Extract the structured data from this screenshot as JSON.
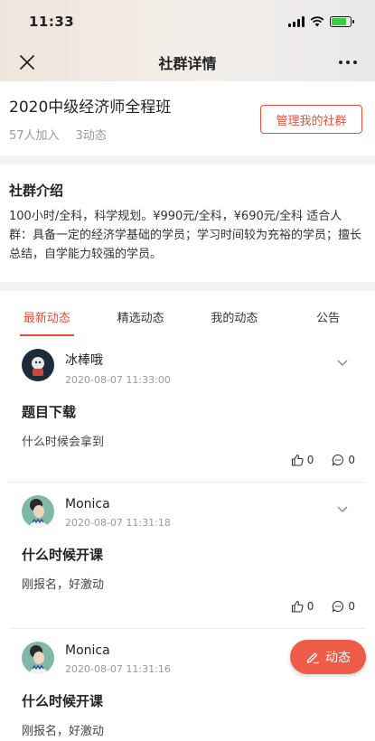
{
  "status_bar": {
    "time": "11:33",
    "battery_level": 0.8
  },
  "nav": {
    "title": "社群详情"
  },
  "group": {
    "name": "2020中级经济师全程班",
    "members": "57人加入",
    "posts": "3动态",
    "manage_label": "管理我的社群"
  },
  "intro": {
    "title": "社群介绍",
    "text": "100小时/全科，科学规划。¥990元/全科，¥690元/全科 适合人群：具备一定的经济学基础的学员；学习时间较为充裕的学员；擅长总结，自学能力较强的学员。"
  },
  "tabs": [
    "最新动态",
    "精选动态",
    "我的动态",
    "公告"
  ],
  "posts": [
    {
      "author": "冰棒哦",
      "time": "2020-08-07 11:33:00",
      "title": "题目下载",
      "body": "什么时候会拿到",
      "likes": "0",
      "comments": "0"
    },
    {
      "author": "Monica",
      "time": "2020-08-07 11:31:18",
      "title": "什么时候开课",
      "body": "刚报名，好激动",
      "likes": "0",
      "comments": "0"
    },
    {
      "author": "Monica",
      "time": "2020-08-07 11:31:16",
      "title": "什么时候开课",
      "body": "刚报名，好激动"
    }
  ],
  "fab": {
    "label": "动态"
  },
  "colors": {
    "accent": "#e8503a",
    "fab": "#ee5b46"
  }
}
